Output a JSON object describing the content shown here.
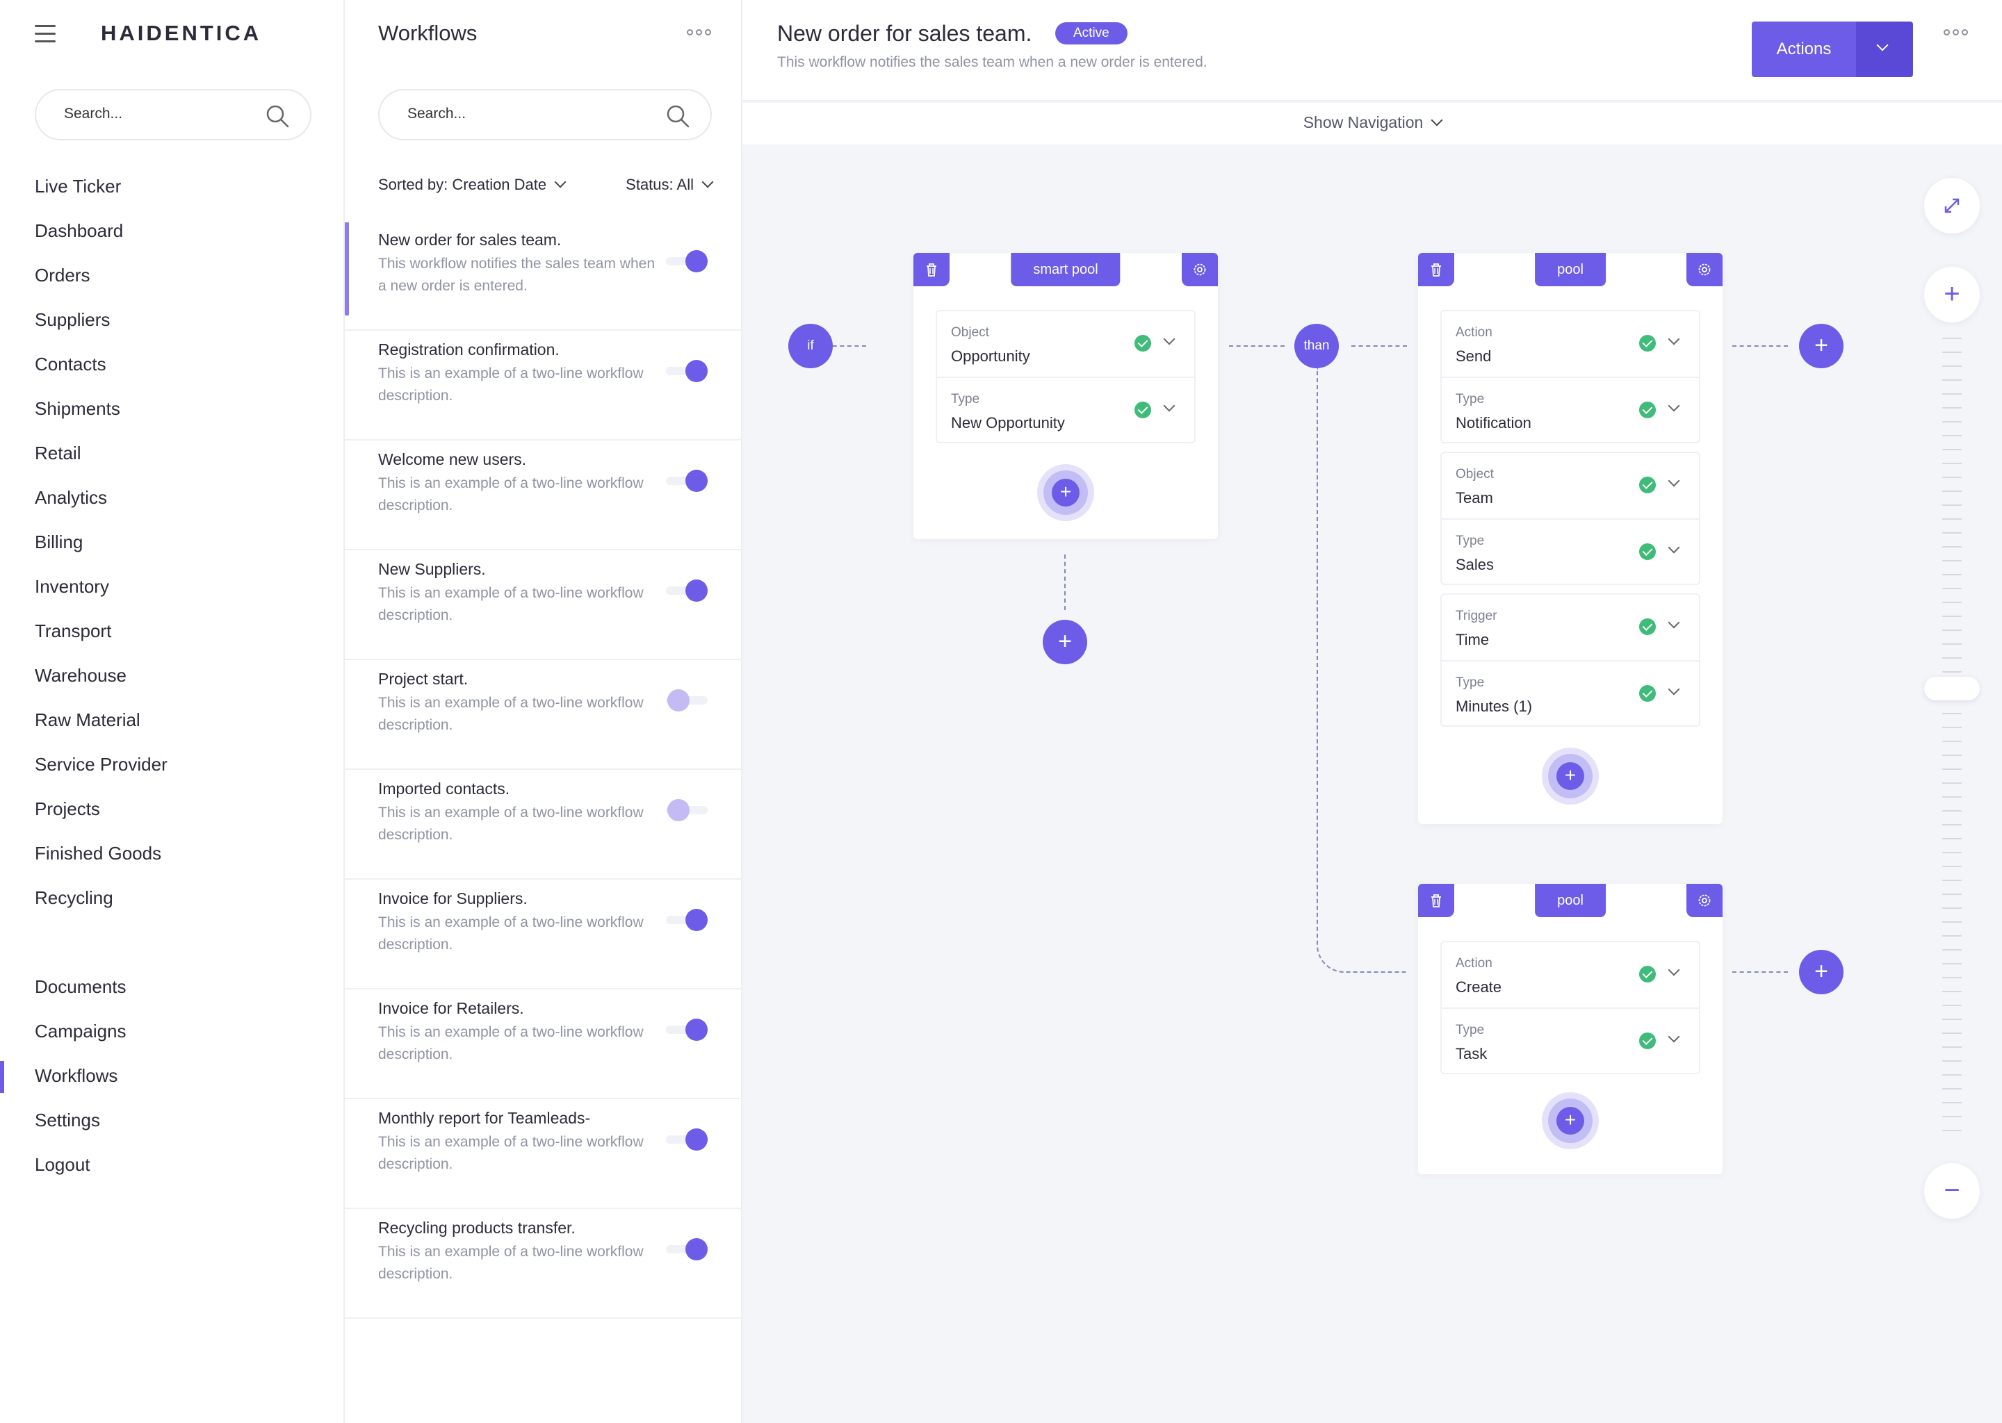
{
  "nav": {
    "logo": "HAIDENTICA",
    "search_placeholder": "Search...",
    "menu_primary": [
      "Live Ticker",
      "Dashboard",
      "Orders",
      "Suppliers",
      "Contacts",
      "Shipments",
      "Retail",
      "Analytics",
      "Billing",
      "Inventory",
      "Transport",
      "Warehouse",
      "Raw Material",
      "Service Provider",
      "Projects",
      "Finished Goods",
      "Recycling"
    ],
    "menu_secondary": [
      "Documents",
      "Campaigns",
      "Workflows",
      "Settings",
      "Logout"
    ],
    "active_item": "Workflows"
  },
  "workflows": {
    "title": "Workflows",
    "search_placeholder": "Search...",
    "sort_label": "Sorted by:  Creation Date",
    "status_label": "Status: All",
    "items": [
      {
        "title": "New order for sales team.",
        "desc": "This workflow notifies the sales team when a new order is entered.",
        "enabled": true,
        "selected": true
      },
      {
        "title": "Registration confirmation.",
        "desc": "This is an example of a two-line workflow description.",
        "enabled": true
      },
      {
        "title": "Welcome new users.",
        "desc": "This is an example of a two-line workflow description.",
        "enabled": true
      },
      {
        "title": "New Suppliers.",
        "desc": "This is an example of a two-line workflow description.",
        "enabled": true
      },
      {
        "title": "Project start.",
        "desc": "This is an example of a two-line workflow description.",
        "enabled": false
      },
      {
        "title": "Imported contacts.",
        "desc": "This is an example of a two-line workflow description.",
        "enabled": false
      },
      {
        "title": "Invoice for Suppliers.",
        "desc": "This is an example of a two-line workflow description.",
        "enabled": true
      },
      {
        "title": "Invoice for Retailers.",
        "desc": "This is an example of a two-line workflow description.",
        "enabled": true
      },
      {
        "title": "Monthly report for Teamleads-",
        "desc": "This is an example of a two-line workflow description.",
        "enabled": true
      },
      {
        "title": "Recycling products transfer.",
        "desc": "This is an example of a two-line workflow description.",
        "enabled": true
      }
    ]
  },
  "header": {
    "title": "New order for sales team.",
    "badge": "Active",
    "description": "This workflow notifies the sales team when a new order is entered.",
    "actions_label": "Actions",
    "show_navigation": "Show Navigation"
  },
  "canvas": {
    "if_label": "if",
    "than_label": "than",
    "card_smart": {
      "tag": "smart pool",
      "groups": [
        [
          {
            "label": "Object",
            "value": "Opportunity"
          },
          {
            "label": "Type",
            "value": "New Opportunity"
          }
        ]
      ]
    },
    "card_pool1": {
      "tag": "pool",
      "groups": [
        [
          {
            "label": "Action",
            "value": "Send"
          },
          {
            "label": "Type",
            "value": "Notification"
          }
        ],
        [
          {
            "label": "Object",
            "value": "Team"
          },
          {
            "label": "Type",
            "value": "Sales"
          }
        ],
        [
          {
            "label": "Trigger",
            "value": "Time"
          },
          {
            "label": "Type",
            "value": "Minutes (1)"
          }
        ]
      ]
    },
    "card_pool2": {
      "tag": "pool",
      "groups": [
        [
          {
            "label": "Action",
            "value": "Create"
          },
          {
            "label": "Type",
            "value": "Task"
          }
        ]
      ]
    }
  },
  "colors": {
    "accent": "#6c5ce7",
    "accent_dark": "#5a49d6",
    "success": "#3fbb7a",
    "canvas_bg": "#f4f5f9"
  },
  "icons": [
    "hamburger-icon",
    "search-icon",
    "chevron-down-icon",
    "more-icon",
    "trash-icon",
    "gear-icon",
    "check-icon",
    "plus-icon",
    "expand-icon",
    "minus-icon"
  ]
}
